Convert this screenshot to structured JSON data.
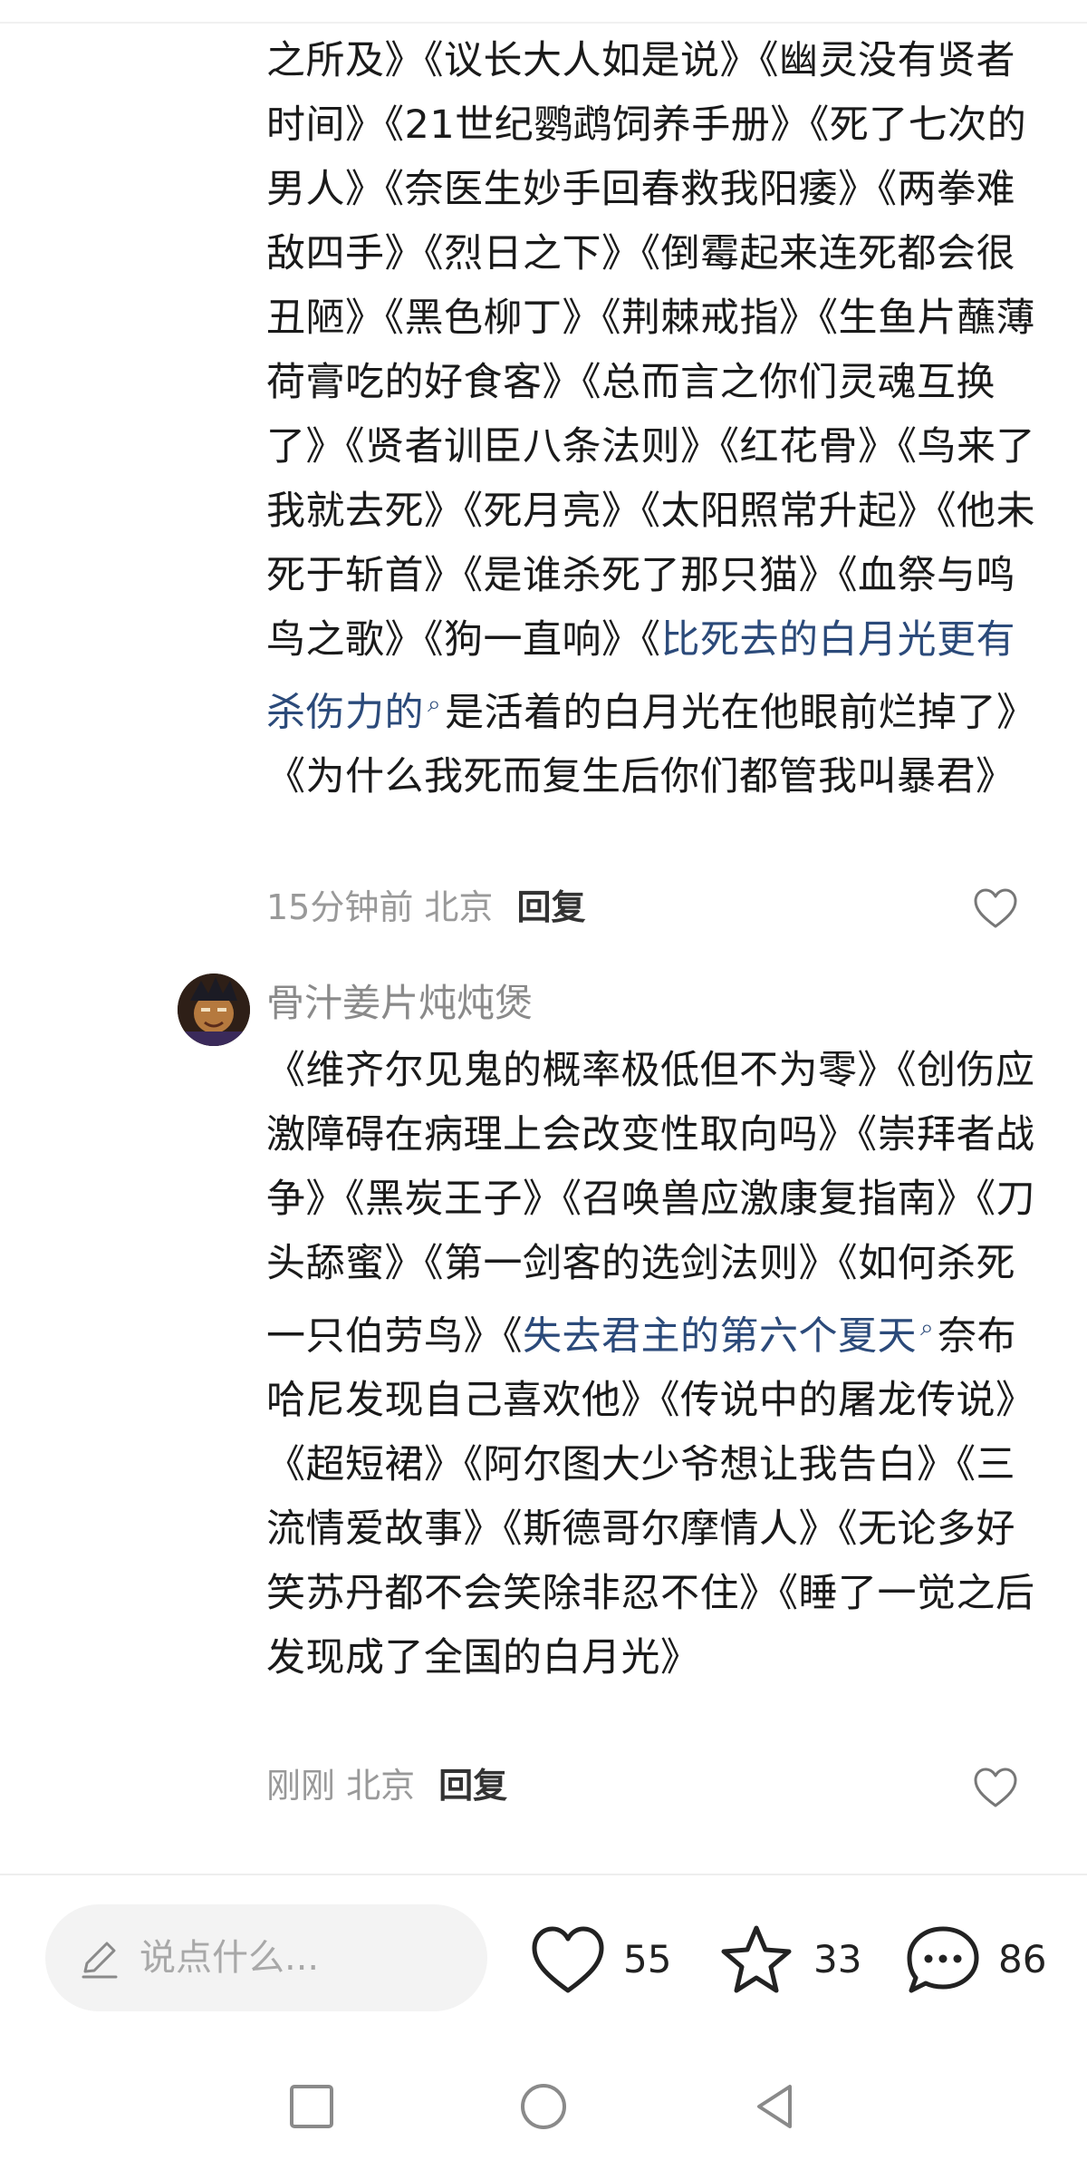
{
  "comments": [
    {
      "text_before": "之所及》《议长大人如是说》《幽灵没有贤者时间》《21世纪鹦鹉饲养手册》《死了七次的男人》《奈医生妙手回春救我阳痿》《两拳难敌四手》《烈日之下》《倒霉起来连死都会很丑陋》《黑色柳丁》《荆棘戒指》《生鱼片蘸薄荷膏吃的好食客》《总而言之你们灵魂互换了》《贤者训臣八条法则》《红花骨》《鸟来了我就去死》《死月亮》《太阳照常升起》《他未死于斩首》《是谁杀死了那只猫》《血祭与鸣鸟之歌》《狗一直响》《",
      "link": "比死去的白月光更有杀伤力的",
      "text_after": "是活着的白月光在他眼前烂掉了》《为什么我死而复生后你们都管我叫暴君》",
      "time_location": "15分钟前 北京",
      "reply_label": "回复"
    },
    {
      "username": "骨汁姜片炖炖煲",
      "text_before": "《维齐尔见鬼的概率极低但不为零》《创伤应激障碍在病理上会改变性取向吗》《崇拜者战争》《黑炭王子》《召唤兽应激康复指南》《刀头舔蜜》《第一剑客的选剑法则》《如何杀死一只伯劳鸟》《",
      "link": "失去君主的第六个夏天",
      "text_after": "奈布哈尼发现自己喜欢他》《传说中的屠龙传说》《超短裙》《阿尔图大少爷想让我告白》《三流情爱故事》《斯德哥尔摩情人》《无论多好笑苏丹都不会笑除非忍不住》《睡了一觉之后发现成了全国的白月光》",
      "time_location": "刚刚 北京",
      "reply_label": "回复"
    }
  ],
  "bottom_bar": {
    "input_placeholder": "说点什么...",
    "likes": "55",
    "favorites": "33",
    "comments": "86"
  },
  "icons": {
    "link": "search-link-icon",
    "heart": "heart-icon",
    "star": "star-icon",
    "comment": "comment-bubble-icon",
    "pen": "pen-icon",
    "nav_recent": "square-icon",
    "nav_home": "circle-icon",
    "nav_back": "triangle-back-icon"
  },
  "colors": {
    "link": "#2b4a7a",
    "meta": "#999999",
    "input_bg": "#f3f3f3"
  }
}
